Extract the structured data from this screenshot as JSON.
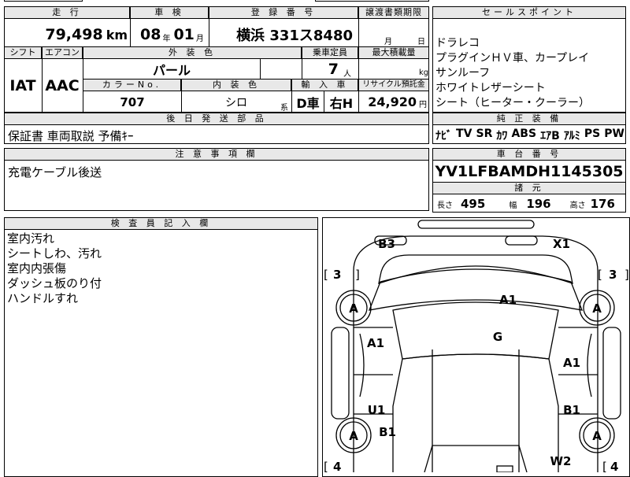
{
  "top": {
    "headers": {
      "mileage": "走 行",
      "inspection": "車 検",
      "registration": "登 録 番 号",
      "transfer_deadline": "譲渡書類期限",
      "sales_point": "セールスポイント"
    },
    "mileage_value": "79,498",
    "mileage_unit": "km",
    "inspection_year": "08",
    "inspection_year_unit": "年",
    "inspection_month": "01",
    "inspection_month_unit": "月",
    "registration_value": "横浜 331ス8480",
    "transfer_month_unit": "月",
    "transfer_day_unit": "日"
  },
  "specs": {
    "headers": {
      "shift": "シフト",
      "aircon": "エアコン",
      "exterior_color": "外 装 色",
      "capacity": "乗車定員",
      "max_load": "最大積載量",
      "color_no": "カラーNo.",
      "interior_color": "内 装 色",
      "import": "輸 入 車",
      "recycle": "リサイクル預託金"
    },
    "shift_value": "IAT",
    "aircon_value": "AAC",
    "exterior_color_value": "パール",
    "capacity_value": "7",
    "capacity_unit": "人",
    "max_load_unit": "kg",
    "color_no_value": "707",
    "interior_color_value": "シロ",
    "interior_color_suffix": "系",
    "import_value": "D車",
    "steering_value": "右H",
    "recycle_value": "24,920",
    "recycle_unit": "円"
  },
  "sales_points": [
    "ドラレコ",
    "プラグインＨＶ車、カープレイ",
    "サンルーフ",
    "ホワイトレザーシート",
    "シート（ヒーター・クーラー）"
  ],
  "later_parts": {
    "header": "後 日 発 送 部 品",
    "value": "保証書 車両取説 予備ｷｰ"
  },
  "genuine_equipment": {
    "header": "純 正 装 備",
    "items": [
      "ﾅﾋﾞ",
      "TV",
      "SR",
      "ｶﾜ",
      "ABS",
      "ｴｱB",
      "ｱﾙﾐ",
      "PS",
      "PW"
    ]
  },
  "notes": {
    "header": "注 意 事 項 欄",
    "value": "充電ケーブル後送"
  },
  "chassis": {
    "header": "車 台 番 号",
    "value": "YV1LFBAMDH1145305"
  },
  "dimensions": {
    "header": "諸 元",
    "length_label": "長さ",
    "length_value": "495",
    "width_label": "幅",
    "width_value": "196",
    "height_label": "高さ",
    "height_value": "176"
  },
  "inspector": {
    "header": "検 査 員 記 入 欄",
    "lines": [
      "室内汚れ",
      "シートしわ、汚れ",
      "室内内張傷",
      "ダッシュ板のり付",
      "ハンドルすれ"
    ]
  },
  "diagram": {
    "marks": {
      "b3": "B3",
      "x1": "X1",
      "a1_hood": "A1",
      "g_windshield": "G",
      "a1_left_front": "A1",
      "a1_right_front": "A1",
      "u1_left_rear": "U1",
      "b1_right_rear": "B1",
      "b1_left_rear": "B1",
      "w2_rear": "W2",
      "tire_front_left": "A",
      "tire_front_right": "A",
      "tire_rear_left": "A",
      "tire_rear_right": "A"
    },
    "tread": {
      "front_left": "3",
      "front_right": "3",
      "rear_left": "4",
      "rear_right": "4"
    }
  }
}
